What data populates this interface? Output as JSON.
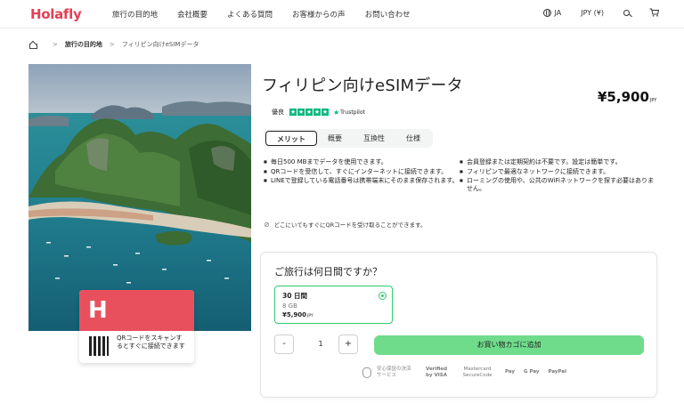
{
  "header": {
    "logo": "Holafly",
    "nav": [
      "旅行の目的地",
      "会社概要",
      "よくある質問",
      "お客様からの声",
      "お問い合わせ"
    ],
    "language": "JA",
    "currency": "JPY (¥)"
  },
  "breadcrumb": {
    "destinations": "旅行の目的地",
    "separator": ">",
    "current": "フィリピン向けeSIMデータ"
  },
  "hero_card": {
    "logo_glyph": "H",
    "qr_text": "QRコードをスキャンするとすぐに接続できます"
  },
  "product": {
    "title": "フィリピン向けeSIMデータ",
    "price": "¥5,900",
    "price_currency": "JPY",
    "rating_label": "優良",
    "trustpilot": "Trustpilot",
    "stars": 5
  },
  "tabs": [
    "メリット",
    "概要",
    "互換性",
    "仕様"
  ],
  "features": {
    "left": [
      "毎日500 MBまでデータを使用できます。",
      "QRコードを受信して、すぐにインターネットに接続できます。",
      "LINEで登録している電話番号は携帯端末にそのまま保存されます。"
    ],
    "right": [
      "会員登録または定期契約は不要です。設定は簡単です。",
      "フィリピンで最適なネットワークに接続できます。",
      "ローミングの使用や、公共のWiFiネットワークを探す必要はありません。"
    ]
  },
  "qr_note": "どこにいてもすぐにQRコードを受け取ることができます。",
  "booking": {
    "question": "ご旅行は何日間ですか？",
    "plan": {
      "duration": "30 日間",
      "data": "8 GB",
      "price": "¥5,900",
      "currency": "JPY"
    },
    "qty_minus": "-",
    "qty_value": "1",
    "qty_plus": "+",
    "add_to_cart": "お買い物カゴに追加",
    "secure_text": "安心保証の決済サービス",
    "payment_methods": [
      "Verified by VISA",
      "Mastercard SecureCode",
      "Pay",
      "G Pay",
      "PayPal"
    ]
  },
  "colors": {
    "brand": "#e63f53",
    "accent_green": "#2ecc71",
    "button_green": "#6fdc8c",
    "trustpilot_green": "#00b67a"
  }
}
